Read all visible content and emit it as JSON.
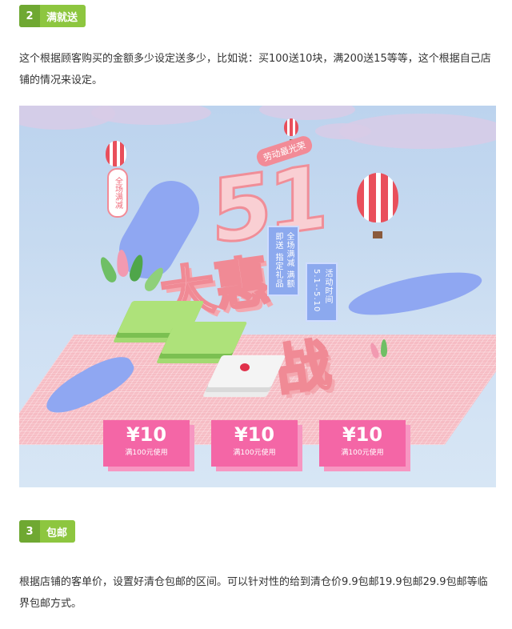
{
  "section2": {
    "number": "2",
    "label": "满就送"
  },
  "para1": "这个根据顾客购买的金额多少设定送多少，比如说：买100送10块，满200送15等等，这个根据自己店铺的情况来设定。",
  "banner": {
    "badge_top": "劳动最光荣",
    "left_pill": "全场满减",
    "big_number": "51",
    "big_title_1": "大惠",
    "big_title_2": "战",
    "sign1": "全场满减 满额即送 指定礼品",
    "sign2": "活动时间 5.1--5.10",
    "coupons": [
      {
        "amount": "¥10",
        "condition": "满100元使用"
      },
      {
        "amount": "¥10",
        "condition": "满100元使用"
      },
      {
        "amount": "¥10",
        "condition": "满100元使用"
      }
    ],
    "colors": {
      "coupon": "#f466a6",
      "accent": "#f08a95",
      "ribbon": "#8fa7f2",
      "floor": "#f6bcc4"
    }
  },
  "section3": {
    "number": "3",
    "label": "包邮"
  },
  "para2": "根据店铺的客单价，设置好清仓包邮的区间。可以针对性的给到清仓价9.9包邮19.9包邮29.9包邮等临界包邮方式。"
}
